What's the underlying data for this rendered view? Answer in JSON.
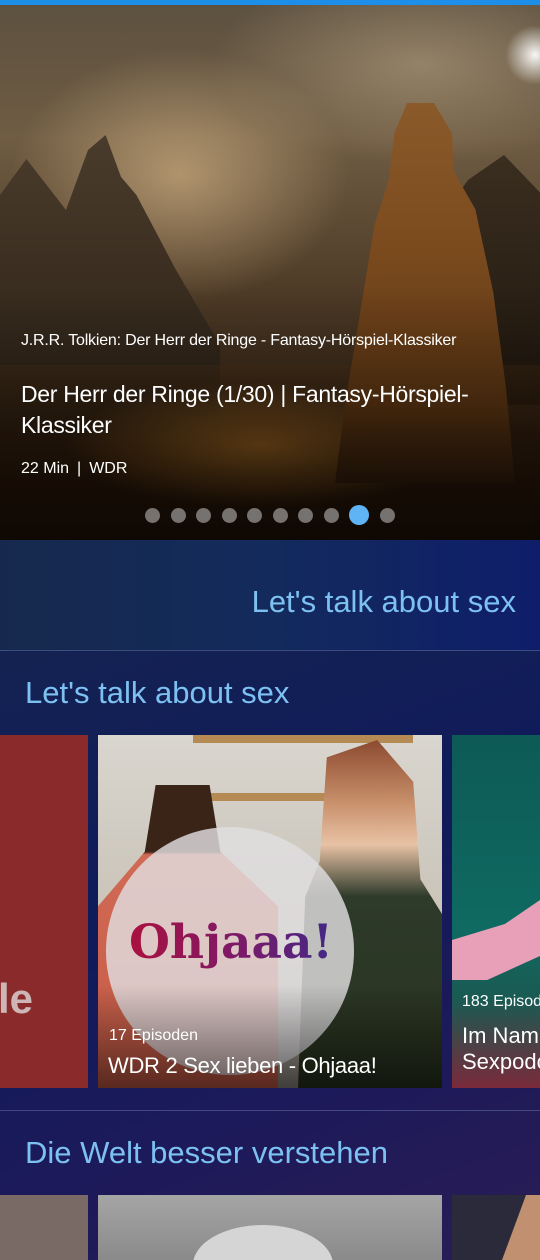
{
  "hero": {
    "subtitle": "J.R.R. Tolkien: Der Herr der Ringe - Fantasy-Hörspiel-Klassiker",
    "title": "Der Herr der Ringe (1/30) | Fantasy-Hörspiel-Klassiker",
    "duration": "22 Min",
    "separator": "|",
    "broadcaster": "WDR",
    "carousel": {
      "count": 10,
      "active_index": 8
    }
  },
  "banner": {
    "title": "Let's talk about sex"
  },
  "sections": [
    {
      "title": "Let's talk about sex",
      "cards": [
        {
          "fragment": "le"
        },
        {
          "logo_text": "Ohjaaa!",
          "episodes": "17 Episoden",
          "name": "WDR 2 Sex lieben - Ohjaaa!"
        },
        {
          "episodes": "183 Episod",
          "name_line1": "Im Nam",
          "name_line2": "Sexpodc"
        }
      ]
    },
    {
      "title": "Die Welt besser verstehen"
    }
  ],
  "colors": {
    "accent": "#7cc1f2",
    "top_bar": "#1e8fe8",
    "dot_active": "#5fb4f5",
    "background": "#0d1844"
  }
}
